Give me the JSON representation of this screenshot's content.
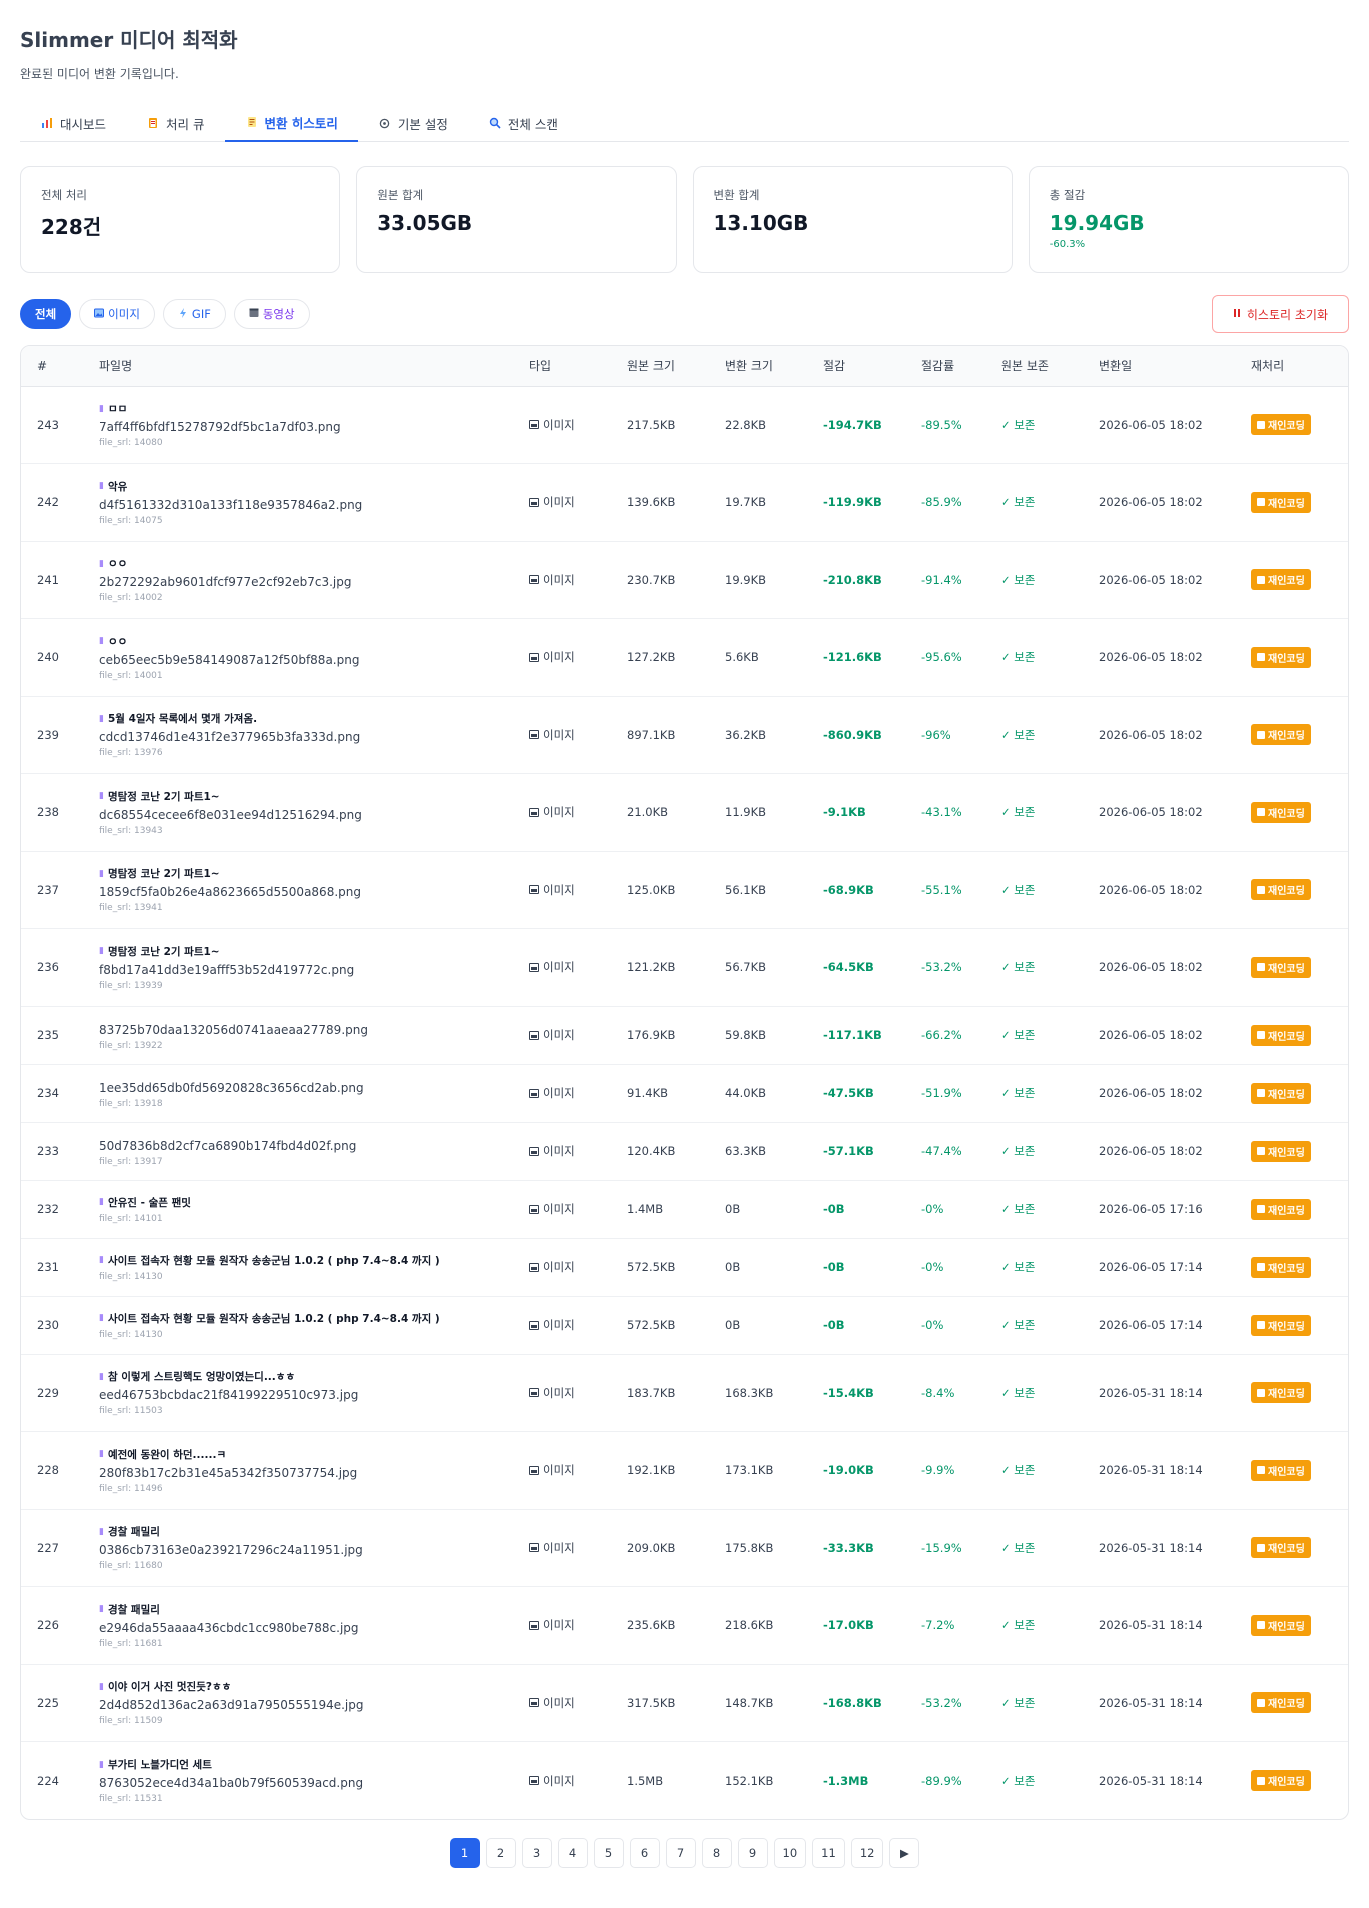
{
  "app": {
    "title": "Slimmer 미디어 최적화",
    "subtitle": "완료된 미디어 변환 기록입니다."
  },
  "tabs": [
    {
      "label": "대시보드",
      "icon": "chart-icon"
    },
    {
      "label": "처리 큐",
      "icon": "clipboard-icon"
    },
    {
      "label": "변환 히스토리",
      "icon": "scroll-icon",
      "active": true
    },
    {
      "label": "기본 설정",
      "icon": "gear-icon"
    },
    {
      "label": "전체 스캔",
      "icon": "search-icon"
    }
  ],
  "stats": [
    {
      "label": "전체 처리",
      "value": "228건"
    },
    {
      "label": "원본 합계",
      "value": "33.05GB"
    },
    {
      "label": "변환 합계",
      "value": "13.10GB"
    },
    {
      "label": "총 절감",
      "value": "19.94GB",
      "sub": "-60.3%"
    }
  ],
  "filters": [
    {
      "label": "전체",
      "active": true
    },
    {
      "label": "이미지",
      "icon": "image-icon"
    },
    {
      "label": "GIF",
      "icon": "gif-icon"
    },
    {
      "label": "동영상",
      "icon": "video-icon"
    }
  ],
  "reset_label": "히스토리 초기화",
  "columns": [
    "#",
    "파일명",
    "타입",
    "원본 크기",
    "변환 크기",
    "절감",
    "절감률",
    "원본 보존",
    "변환일",
    "재처리"
  ],
  "rows": [
    {
      "id": "243",
      "title": "ㅁㅁ",
      "file": "7aff4ff6bfdf15278792df5bc1a7df03.png",
      "srl": "file_srl: 14080",
      "type": "이미지",
      "orig": "217.5KB",
      "conv": "22.8KB",
      "saved": "-194.7KB",
      "rate": "-89.5%",
      "keep": "✓ 보존",
      "date": "2026-06-05 18:02",
      "action": "재인코딩"
    },
    {
      "id": "242",
      "title": "악유",
      "file": "d4f5161332d310a133f118e9357846a2.png",
      "srl": "file_srl: 14075",
      "type": "이미지",
      "orig": "139.6KB",
      "conv": "19.7KB",
      "saved": "-119.9KB",
      "rate": "-85.9%",
      "keep": "✓ 보존",
      "date": "2026-06-05 18:02",
      "action": "재인코딩"
    },
    {
      "id": "241",
      "title": "ㅇㅇ",
      "file": "2b272292ab9601dfcf977e2cf92eb7c3.jpg",
      "srl": "file_srl: 14002",
      "type": "이미지",
      "orig": "230.7KB",
      "conv": "19.9KB",
      "saved": "-210.8KB",
      "rate": "-91.4%",
      "keep": "✓ 보존",
      "date": "2026-06-05 18:02",
      "action": "재인코딩"
    },
    {
      "id": "240",
      "title": "ㅇㅇ",
      "file": "ceb65eec5b9e584149087a12f50bf88a.png",
      "srl": "file_srl: 14001",
      "type": "이미지",
      "orig": "127.2KB",
      "conv": "5.6KB",
      "saved": "-121.6KB",
      "rate": "-95.6%",
      "keep": "✓ 보존",
      "date": "2026-06-05 18:02",
      "action": "재인코딩"
    },
    {
      "id": "239",
      "title": "5월 4일자 목록에서 몇개 가져옴.",
      "file": "cdcd13746d1e431f2e377965b3fa333d.png",
      "srl": "file_srl: 13976",
      "type": "이미지",
      "orig": "897.1KB",
      "conv": "36.2KB",
      "saved": "-860.9KB",
      "rate": "-96%",
      "keep": "✓ 보존",
      "date": "2026-06-05 18:02",
      "action": "재인코딩"
    },
    {
      "id": "238",
      "title": "명탐정 코난 2기 파트1~",
      "file": "dc68554cecee6f8e031ee94d12516294.png",
      "srl": "file_srl: 13943",
      "type": "이미지",
      "orig": "21.0KB",
      "conv": "11.9KB",
      "saved": "-9.1KB",
      "rate": "-43.1%",
      "keep": "✓ 보존",
      "date": "2026-06-05 18:02",
      "action": "재인코딩"
    },
    {
      "id": "237",
      "title": "명탐정 코난 2기 파트1~",
      "file": "1859cf5fa0b26e4a8623665d5500a868.png",
      "srl": "file_srl: 13941",
      "type": "이미지",
      "orig": "125.0KB",
      "conv": "56.1KB",
      "saved": "-68.9KB",
      "rate": "-55.1%",
      "keep": "✓ 보존",
      "date": "2026-06-05 18:02",
      "action": "재인코딩"
    },
    {
      "id": "236",
      "title": "명탐정 코난 2기 파트1~",
      "file": "f8bd17a41dd3e19afff53b52d419772c.png",
      "srl": "file_srl: 13939",
      "type": "이미지",
      "orig": "121.2KB",
      "conv": "56.7KB",
      "saved": "-64.5KB",
      "rate": "-53.2%",
      "keep": "✓ 보존",
      "date": "2026-06-05 18:02",
      "action": "재인코딩"
    },
    {
      "id": "235",
      "title": "",
      "file": "83725b70daa132056d0741aaeaa27789.png",
      "srl": "file_srl: 13922",
      "type": "이미지",
      "orig": "176.9KB",
      "conv": "59.8KB",
      "saved": "-117.1KB",
      "rate": "-66.2%",
      "keep": "✓ 보존",
      "date": "2026-06-05 18:02",
      "action": "재인코딩"
    },
    {
      "id": "234",
      "title": "",
      "file": "1ee35dd65db0fd56920828c3656cd2ab.png",
      "srl": "file_srl: 13918",
      "type": "이미지",
      "orig": "91.4KB",
      "conv": "44.0KB",
      "saved": "-47.5KB",
      "rate": "-51.9%",
      "keep": "✓ 보존",
      "date": "2026-06-05 18:02",
      "action": "재인코딩"
    },
    {
      "id": "233",
      "title": "",
      "file": "50d7836b8d2cf7ca6890b174fbd4d02f.png",
      "srl": "file_srl: 13917",
      "type": "이미지",
      "orig": "120.4KB",
      "conv": "63.3KB",
      "saved": "-57.1KB",
      "rate": "-47.4%",
      "keep": "✓ 보존",
      "date": "2026-06-05 18:02",
      "action": "재인코딩"
    },
    {
      "id": "232",
      "title": "안유진 - 술픈 팬밋",
      "file": "",
      "srl": "file_srl: 14101",
      "type": "이미지",
      "orig": "1.4MB",
      "conv": "0B",
      "saved": "-0B",
      "rate": "-0%",
      "keep": "✓ 보존",
      "date": "2026-06-05 17:16",
      "action": "재인코딩"
    },
    {
      "id": "231",
      "title": "사이트 접속자 현황 모듈 원작자 송송군님 1.0.2 ( php 7.4~8.4 까지 )",
      "file": "",
      "srl": "file_srl: 14130",
      "type": "이미지",
      "orig": "572.5KB",
      "conv": "0B",
      "saved": "-0B",
      "rate": "-0%",
      "keep": "✓ 보존",
      "date": "2026-06-05 17:14",
      "action": "재인코딩"
    },
    {
      "id": "230",
      "title": "사이트 접속자 현황 모듈 원작자 송송군님 1.0.2 ( php 7.4~8.4 까지 )",
      "file": "",
      "srl": "file_srl: 14130",
      "type": "이미지",
      "orig": "572.5KB",
      "conv": "0B",
      "saved": "-0B",
      "rate": "-0%",
      "keep": "✓ 보존",
      "date": "2026-06-05 17:14",
      "action": "재인코딩"
    },
    {
      "id": "229",
      "title": "참 이렇게 스트링핵도 엉망이였는디...ㅎㅎ",
      "file": "eed46753bcbdac21f84199229510c973.jpg",
      "srl": "file_srl: 11503",
      "type": "이미지",
      "orig": "183.7KB",
      "conv": "168.3KB",
      "saved": "-15.4KB",
      "rate": "-8.4%",
      "keep": "✓ 보존",
      "date": "2026-05-31 18:14",
      "action": "재인코딩"
    },
    {
      "id": "228",
      "title": "예전에 동완이 하던......ㅋ",
      "file": "280f83b17c2b31e45a5342f350737754.jpg",
      "srl": "file_srl: 11496",
      "type": "이미지",
      "orig": "192.1KB",
      "conv": "173.1KB",
      "saved": "-19.0KB",
      "rate": "-9.9%",
      "keep": "✓ 보존",
      "date": "2026-05-31 18:14",
      "action": "재인코딩"
    },
    {
      "id": "227",
      "title": "경찰 패밀리",
      "file": "0386cb73163e0a239217296c24a11951.jpg",
      "srl": "file_srl: 11680",
      "type": "이미지",
      "orig": "209.0KB",
      "conv": "175.8KB",
      "saved": "-33.3KB",
      "rate": "-15.9%",
      "keep": "✓ 보존",
      "date": "2026-05-31 18:14",
      "action": "재인코딩"
    },
    {
      "id": "226",
      "title": "경찰 패밀리",
      "file": "e2946da55aaaa436cbdc1cc980be788c.jpg",
      "srl": "file_srl: 11681",
      "type": "이미지",
      "orig": "235.6KB",
      "conv": "218.6KB",
      "saved": "-17.0KB",
      "rate": "-7.2%",
      "keep": "✓ 보존",
      "date": "2026-05-31 18:14",
      "action": "재인코딩"
    },
    {
      "id": "225",
      "title": "이야 이거 사진 멋진듯?ㅎㅎ",
      "file": "2d4d852d136ac2a63d91a7950555194e.jpg",
      "srl": "file_srl: 11509",
      "type": "이미지",
      "orig": "317.5KB",
      "conv": "148.7KB",
      "saved": "-168.8KB",
      "rate": "-53.2%",
      "keep": "✓ 보존",
      "date": "2026-05-31 18:14",
      "action": "재인코딩"
    },
    {
      "id": "224",
      "title": "부가티 노블가디언 세트",
      "file": "8763052ece4d34a1ba0b79f560539acd.png",
      "srl": "file_srl: 11531",
      "type": "이미지",
      "orig": "1.5MB",
      "conv": "152.1KB",
      "saved": "-1.3MB",
      "rate": "-89.9%",
      "keep": "✓ 보존",
      "date": "2026-05-31 18:14",
      "action": "재인코딩"
    }
  ],
  "pagination": {
    "pages": [
      "1",
      "2",
      "3",
      "4",
      "5",
      "6",
      "7",
      "8",
      "9",
      "10",
      "11",
      "12"
    ],
    "current": "1",
    "next": "▶"
  },
  "colors": {
    "accent": "#2563eb",
    "green": "#059669",
    "danger": "#dc2626",
    "orange": "#f59e0b"
  }
}
